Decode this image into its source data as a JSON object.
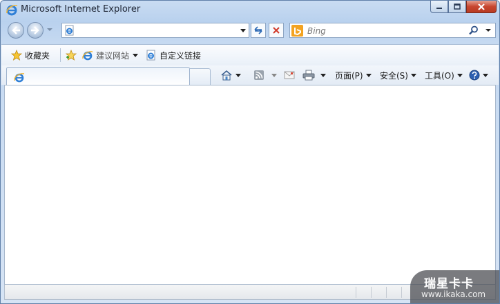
{
  "window": {
    "title": "Microsoft Internet Explorer"
  },
  "navbar": {
    "address_value": "",
    "search_placeholder": "Bing"
  },
  "favorites_bar": {
    "favorites_label": "收藏夹",
    "suggested_sites_label": "建议网站",
    "custom_links_label": "自定义链接"
  },
  "command_bar": {
    "page_label": "页面(P)",
    "safety_label": "安全(S)",
    "tools_label": "工具(O)"
  },
  "watermark": {
    "title": "瑞星卡卡",
    "url": "www.ikaka.com"
  },
  "colors": {
    "frame": "#c5d9f1",
    "close_button": "#c7462f",
    "bing_logo": "#f3a321"
  }
}
